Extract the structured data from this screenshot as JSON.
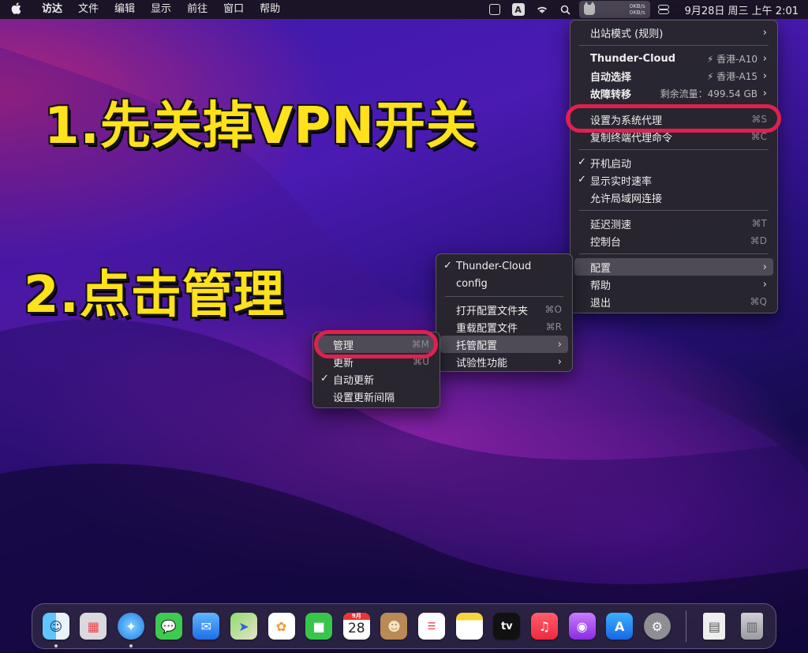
{
  "menubar": {
    "apple": "",
    "items": [
      "访达",
      "文件",
      "编辑",
      "显示",
      "前往",
      "窗口",
      "帮助"
    ],
    "status": {
      "a_label": "A",
      "speed_up": "0KB/s",
      "speed_down": "0KB/s",
      "clock": "9月28日 周三 上午 2:01"
    }
  },
  "captions": {
    "step1": "1.先关掉VPN开关",
    "step2": "2.点击管理"
  },
  "main_menu": {
    "outbound_mode": "出站模式 (规则)",
    "proxies": [
      {
        "name": "Thunder-Cloud",
        "value": "⚡ 香港-A10"
      },
      {
        "name": "自动选择",
        "value": "⚡ 香港-A15"
      },
      {
        "name": "故障转移",
        "value": "剩余流量：499.54 GB"
      }
    ],
    "set_system_proxy": {
      "label": "设置为系统代理",
      "shortcut": "⌘S"
    },
    "copy_terminal": {
      "label": "复制终端代理命令",
      "shortcut": "⌘C"
    },
    "start_on_boot": "开机启动",
    "show_speed": "显示实时速率",
    "allow_lan": "允许局域网连接",
    "latency_test": {
      "label": "延迟测速",
      "shortcut": "⌘T"
    },
    "dashboard": {
      "label": "控制台",
      "shortcut": "⌘D"
    },
    "config": "配置",
    "help": "帮助",
    "quit": {
      "label": "退出",
      "shortcut": "⌘Q"
    }
  },
  "config_menu": {
    "profiles": [
      "Thunder-Cloud",
      "config"
    ],
    "open_folder": {
      "label": "打开配置文件夹",
      "shortcut": "⌘O"
    },
    "reload": {
      "label": "重载配置文件",
      "shortcut": "⌘R"
    },
    "managed": "托管配置",
    "experimental": "试验性功能"
  },
  "managed_menu": {
    "manage": {
      "label": "管理",
      "shortcut": "⌘M"
    },
    "update": {
      "label": "更新",
      "shortcut": "⌘U"
    },
    "auto_update": "自动更新",
    "update_interval": "设置更新间隔"
  },
  "dock": {
    "calendar_month": "9月",
    "calendar_day": "28",
    "tv_label": "tv"
  },
  "colors": {
    "caption": "#ffe11c",
    "highlight_ring": "#e0204f",
    "menu_bg": "#28262c"
  }
}
